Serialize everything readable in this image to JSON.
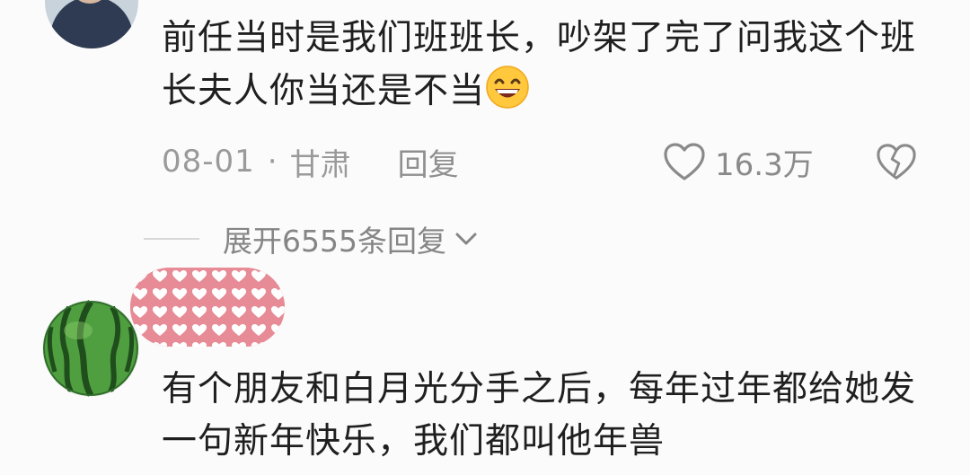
{
  "comments": [
    {
      "text": "前任当时是我们班班长，吵架了完了问我这个班长夫人你当还是不当",
      "date": "08-01",
      "separator": "·",
      "location": "甘肃",
      "reply_label": "回复",
      "likes": "16.3万",
      "icons": {
        "emoji": "grinning-emoji-icon",
        "like": "heart-outline-icon",
        "dislike": "broken-heart-icon"
      }
    },
    {
      "text": "有个朋友和白月光分手之后，每年过年都给她发一句新年快乐，我们都叫他年兽",
      "avatar": "watermelon-avatar",
      "username_obscured": true
    }
  ],
  "expand": {
    "label": "展开6555条回复",
    "icon": "chevron-down-icon"
  },
  "colors": {
    "background": "#fbfbfb",
    "text": "#1f1f1f",
    "meta": "#9a9a9a",
    "censor_pink": "#e78b96",
    "watermelon_green": "#3f8f3a"
  }
}
